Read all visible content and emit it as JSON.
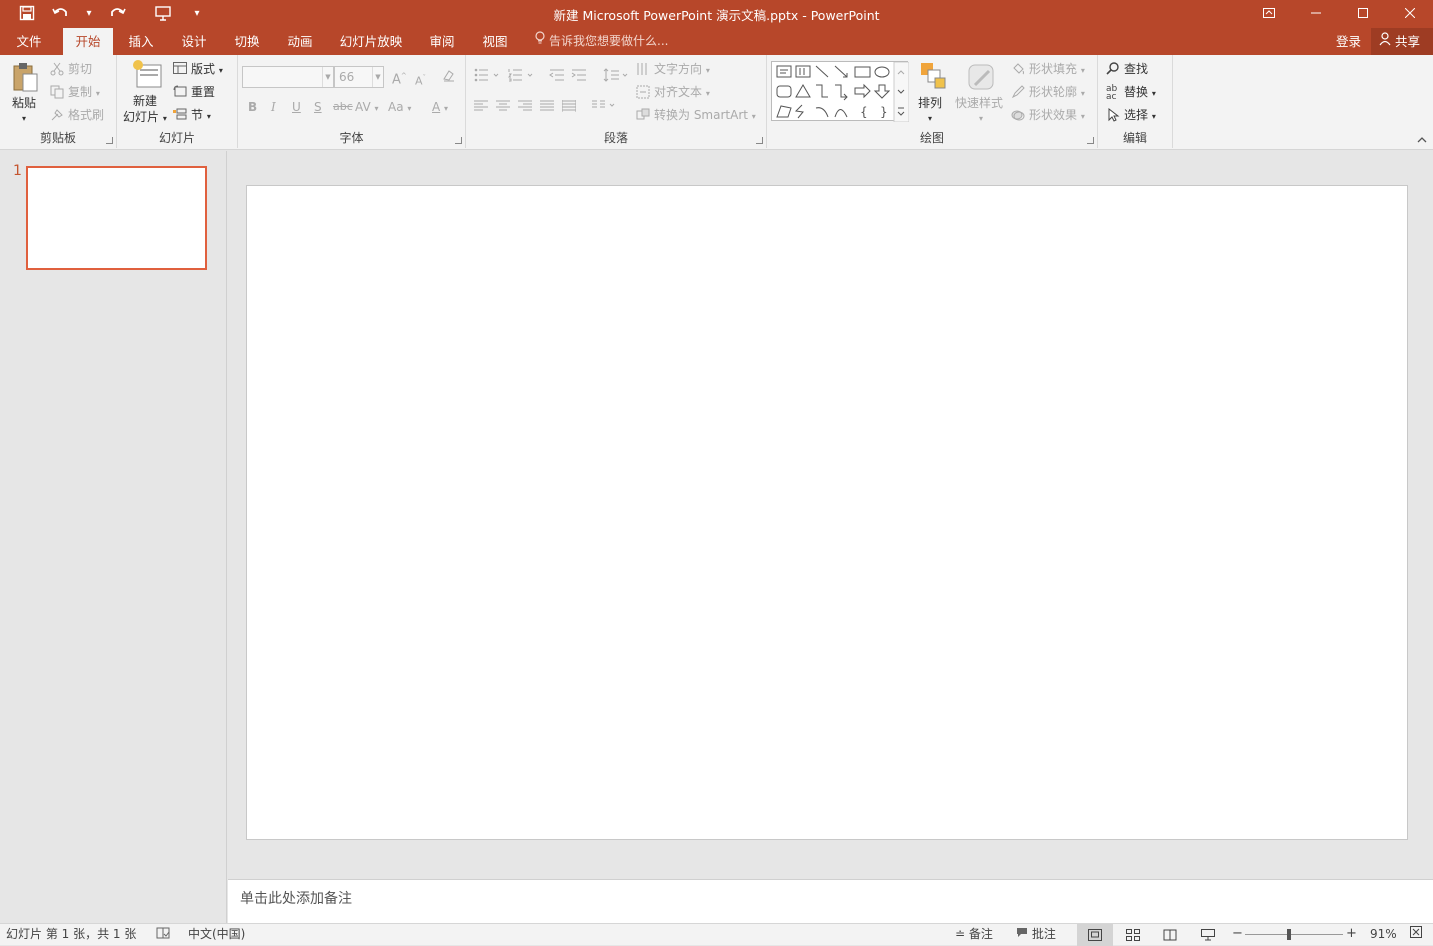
{
  "titlebar": {
    "title": "新建 Microsoft PowerPoint 演示文稿.pptx - PowerPoint",
    "icons": [
      "save-icon",
      "undo-icon",
      "redo-icon",
      "start-slideshow-icon",
      "customize-qat-icon"
    ],
    "window_controls": [
      "ribbon-display-icon",
      "minimize-icon",
      "maximize-icon",
      "close-icon"
    ]
  },
  "tabs": [
    "文件",
    "开始",
    "插入",
    "设计",
    "切换",
    "动画",
    "幻灯片放映",
    "审阅",
    "视图"
  ],
  "active_tab": "开始",
  "tell_me": "告诉我您想要做什么...",
  "login": "登录",
  "share": "共享",
  "ribbon": {
    "clipboard": {
      "label": "剪贴板",
      "paste": "粘贴",
      "cut": "剪切",
      "copy": "复制",
      "format_painter": "格式刷"
    },
    "slides": {
      "label": "幻灯片",
      "new_slide_1": "新建",
      "new_slide_2": "幻灯片",
      "layout": "版式",
      "reset": "重置",
      "section": "节"
    },
    "font": {
      "label": "字体",
      "font_name": "",
      "font_size": "66",
      "bold": "B",
      "italic": "I",
      "underline": "U",
      "shadow": "S",
      "strike": "abc",
      "spacing": "AV",
      "case": "Aa",
      "color": "A",
      "grow": "A",
      "shrink": "A"
    },
    "paragraph": {
      "label": "段落",
      "text_direction": "文字方向",
      "align_text": "对齐文本",
      "smartart": "转换为 SmartArt"
    },
    "drawing": {
      "label": "绘图",
      "arrange": "排列",
      "quick_styles": "快速样式",
      "shape_fill": "形状填充",
      "shape_outline": "形状轮廓",
      "shape_effects": "形状效果"
    },
    "editing": {
      "label": "编辑",
      "find": "查找",
      "replace": "替换",
      "select": "选择"
    }
  },
  "thumbnail": {
    "number": "1"
  },
  "notes_placeholder": "单击此处添加备注",
  "status": {
    "slide_info": "幻灯片 第 1 张，共 1 张",
    "language": "中文(中国)",
    "notes": "备注",
    "comments": "批注",
    "zoom": "91%",
    "zoom_level_percent": 91
  },
  "colors": {
    "accent": "#b7472a",
    "ribbon_bg": "#f3f3f3",
    "selection": "#e0603e"
  }
}
